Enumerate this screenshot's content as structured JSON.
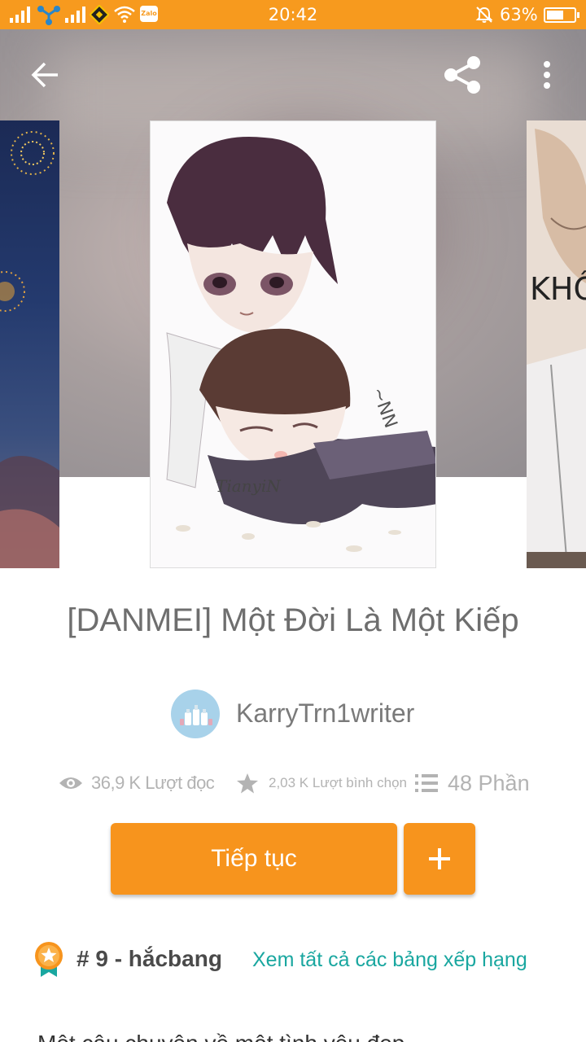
{
  "status_bar": {
    "time": "20:42",
    "battery_percent": "63%",
    "battery_level": 0.63,
    "app_icon": "Zalo",
    "icons": [
      "signal-icon",
      "network-icon",
      "signal-icon",
      "diamond-app-icon",
      "wifi-icon",
      "zalo-icon",
      "mute-bell-icon",
      "battery-icon"
    ]
  },
  "topbar": {
    "back_icon": "back-arrow-icon",
    "share_icon": "share-icon",
    "more_icon": "more-vertical-icon"
  },
  "covers": {
    "main_watermark": "TianyiN"
  },
  "story": {
    "title": "[DANMEI] Một Đời Là Một Kiếp",
    "author": "KarryTrn1writer"
  },
  "stats": {
    "reads": "36,9 K Lượt đọc",
    "votes": "2,03 K Lượt bình chọn",
    "parts": "48 Phần"
  },
  "actions": {
    "continue_label": "Tiếp tục",
    "add_label": "+"
  },
  "ranking": {
    "text": "# 9 - hắcbang",
    "link": "Xem tất cả các bảng xếp hạng"
  },
  "description_peek": "Một câu chuyện về một tình yêu đẹp",
  "colors": {
    "accent": "#f7941d",
    "status_bar": "#f79a1e",
    "link": "#1aa7a0",
    "muted_text": "#b3b3b3"
  }
}
